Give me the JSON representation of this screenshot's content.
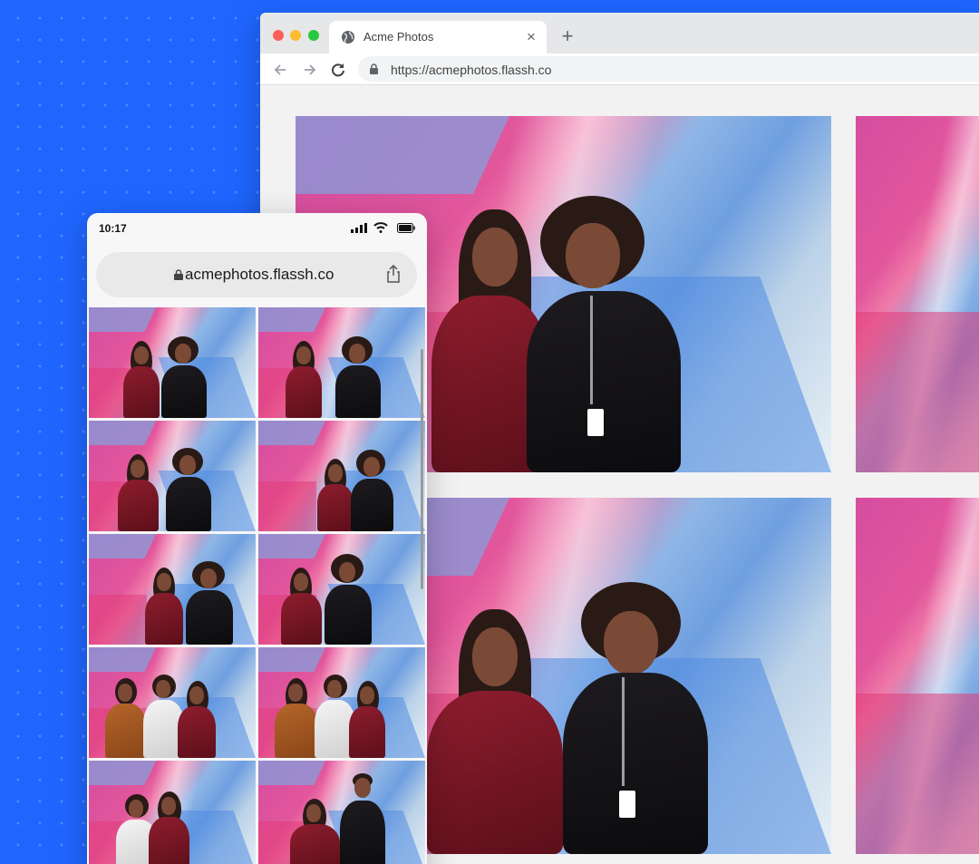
{
  "browser": {
    "tab_title": "Acme Photos",
    "tab_icon": "globe-icon",
    "close_glyph": "×",
    "new_tab_glyph": "+",
    "url": "https://acmephotos.flassh.co"
  },
  "mobile": {
    "time": "10:17",
    "url": "acmephotos.flassh.co",
    "grid_count": 10
  },
  "colors": {
    "background": "#1f66ff",
    "close_red": "#fd5f57",
    "minimize_yellow": "#febc2e",
    "zoom_green": "#28c840"
  }
}
